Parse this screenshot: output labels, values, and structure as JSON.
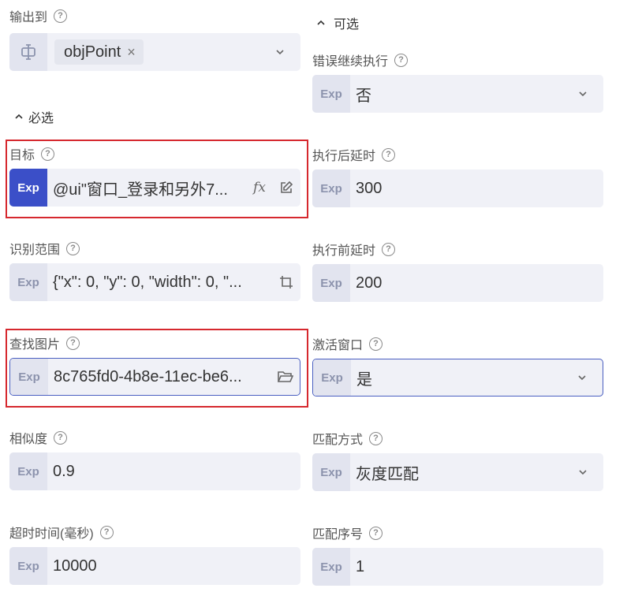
{
  "output": {
    "label": "输出到",
    "tag": "objPoint",
    "tag_remove": "×"
  },
  "sections": {
    "required": "必选",
    "optional": "可选"
  },
  "exp_label": "Exp",
  "left": {
    "target": {
      "label": "目标",
      "value": "@ui\"窗口_登录和另外7..."
    },
    "region": {
      "label": "识别范围",
      "value": "{\"x\": 0, \"y\": 0, \"width\": 0, \"..."
    },
    "image": {
      "label": "查找图片",
      "value": "8c765fd0-4b8e-11ec-be6..."
    },
    "similarity": {
      "label": "相似度",
      "value": "0.9"
    },
    "timeout": {
      "label": "超时时间(毫秒)",
      "value": "10000"
    }
  },
  "right": {
    "continue_on_error": {
      "label": "错误继续执行",
      "value": "否"
    },
    "delay_after": {
      "label": "执行后延时",
      "value": "300"
    },
    "delay_before": {
      "label": "执行前延时",
      "value": "200"
    },
    "activate_window": {
      "label": "激活窗口",
      "value": "是"
    },
    "match_mode": {
      "label": "匹配方式",
      "value": "灰度匹配"
    },
    "match_index": {
      "label": "匹配序号",
      "value": "1"
    }
  },
  "icons": {
    "help": "?",
    "caret_up": "^",
    "fx": "fx"
  },
  "colors": {
    "accent": "#3b4fc8",
    "highlight_box": "#d6282e",
    "field_bg": "#f0f1f7"
  }
}
